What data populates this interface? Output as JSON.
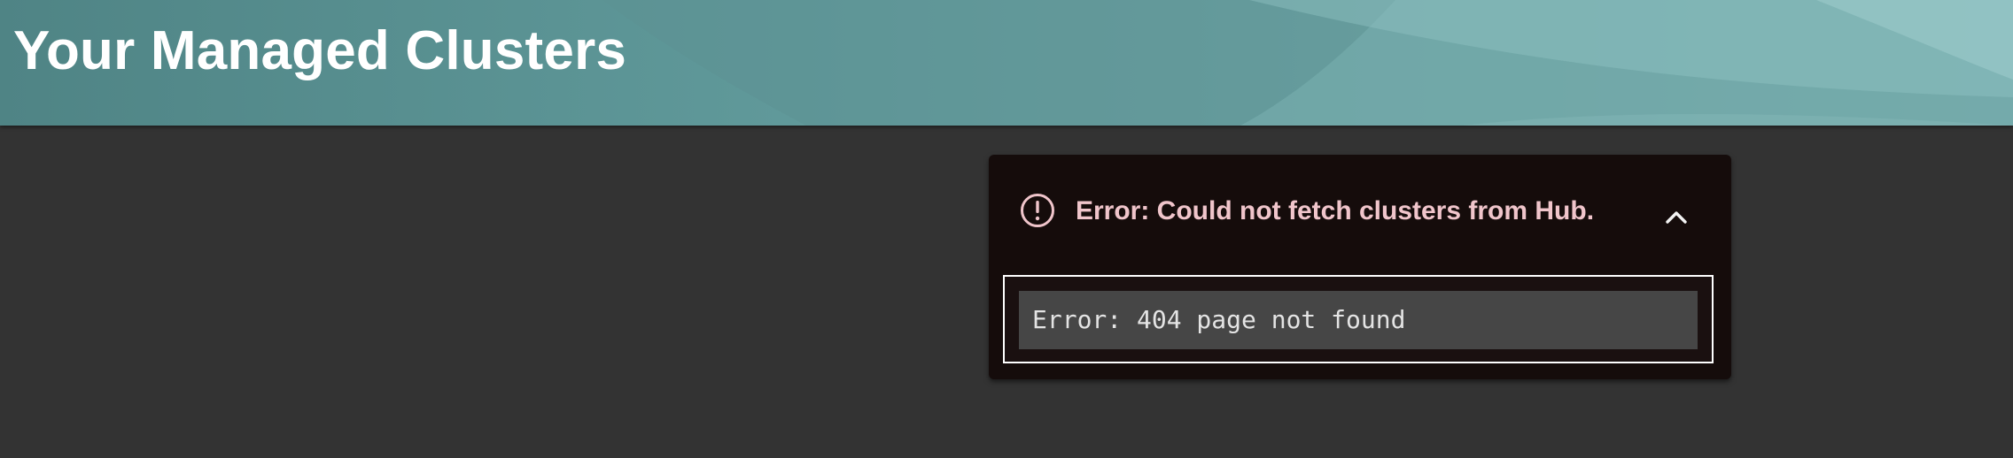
{
  "header": {
    "title": "Your Managed Clusters"
  },
  "alert": {
    "variant": "danger",
    "icon": "exclamation-circle-icon",
    "collapse_icon": "chevron-up-icon",
    "title": "Error: Could not fetch clusters from Hub.",
    "message": "Error: 404 page not found",
    "expanded": true,
    "colors": {
      "background": "#150c0b",
      "title": "#f0c5cb",
      "body_border": "#ffffff",
      "code_background": "#464646"
    }
  },
  "colors": {
    "page_background": "#333333",
    "header_gradient_start": "#4f8485",
    "header_gradient_end": "#86bbbb"
  }
}
